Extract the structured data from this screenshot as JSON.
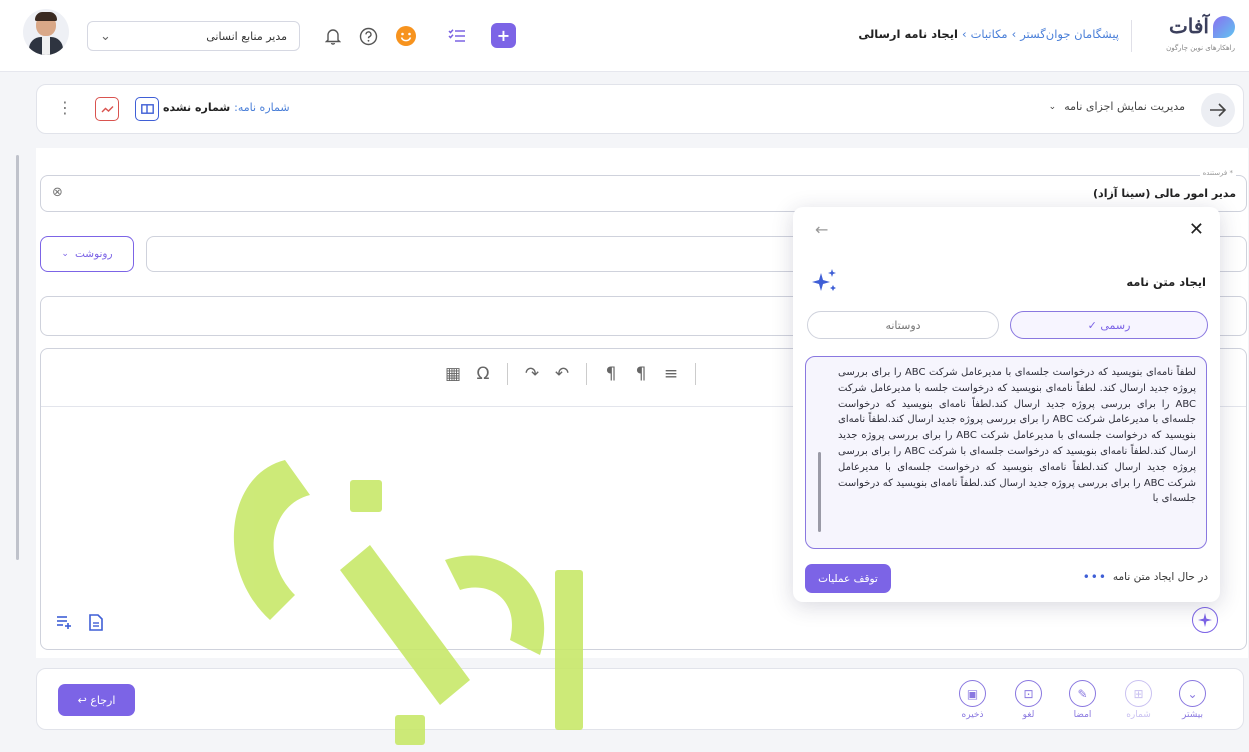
{
  "header": {
    "logo_text": "آفات",
    "logo_subtitle": "راهکارهای نوین چارگون",
    "breadcrumb": [
      "پیشگامان جوان‌گستر",
      "مکاتبات",
      "ایجاد نامه ارسالی"
    ],
    "breadcrumb_sep": "›",
    "role_label": "مدیر منابع انسانی",
    "role_chevron": "⌄"
  },
  "subbar": {
    "display_parts_label": "مدیریت نمایش اجزای نامه",
    "letter_number_label": "شماره نامه:",
    "letter_number_value": "شماره نشده",
    "more": "⋮"
  },
  "form": {
    "sender_caption": "فرستنده *",
    "sender_value": "مدیر امور مالی (سینا آزاد)",
    "cc_button_label": "رونوشت",
    "clear_symbol": "⊗"
  },
  "popup": {
    "title": "ایجاد متن نامه",
    "close": "✕",
    "back": "←",
    "tone_formal": "✓ رسمی",
    "tone_friendly": "دوستانه",
    "body_text": "لطفاً نامه‌ای بنویسید که درخواست جلسه‌ای با مدیرعامل شرکت ABC را برای بررسی پروژه جدید ارسال کند. لطفاً نامه‌ای بنویسید که درخواست جلسه با مدیرعامل شرکت ABC را برای بررسی پروژه جدید ارسال کند.لطفاً نامه‌ای بنویسید که درخواست جلسه‌ای با مدیرعامل شرکت ABC را برای بررسی پروژه جدید ارسال کند.لطفاً نامه‌ای بنویسید که درخواست جلسه‌ای با مدیرعامل شرکت ABC را برای بررسی پروژه جدید ارسال کند.لطفاً نامه‌ای بنویسید که درخواست جلسه‌ای با شرکت ABC را برای بررسی پروژه جدید ارسال کند.لطفاً نامه‌ای بنویسید که درخواست جلسه‌ای با مدیرعامل شرکت ABC را برای بررسی پروژه جدید ارسال کند.لطفاً نامه‌ای بنویسید که درخواست جلسه‌ای با",
    "status_text": "در حال ایجاد متن نامه",
    "status_dots": "•••",
    "stop_label": "توقف عملیات"
  },
  "actions": {
    "return_label": "↩ ارجاع",
    "items": [
      {
        "label": "ذخیره",
        "glyph": "▣"
      },
      {
        "label": "لغو",
        "glyph": "⊡"
      },
      {
        "label": "امضا",
        "glyph": "✎"
      },
      {
        "label": "شماره",
        "glyph": "⊞"
      },
      {
        "label": "بیشتر",
        "glyph": "⌄"
      }
    ]
  },
  "colors": {
    "accent": "#6b55d6",
    "breadcrumb_link": "#4a7fd8",
    "watermark": "#c8e86a"
  }
}
